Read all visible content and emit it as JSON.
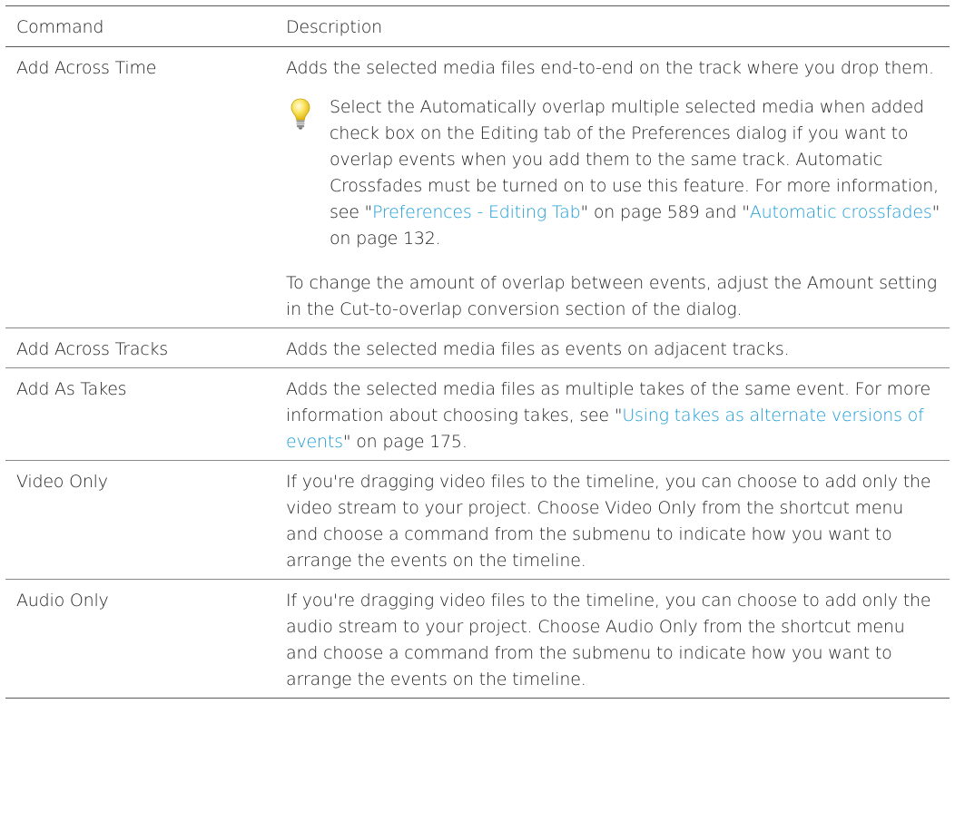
{
  "table": {
    "headers": {
      "command": "Command",
      "description": "Description"
    },
    "rows": [
      {
        "command": "Add Across Time",
        "description": "Adds the selected media files end-to-end on the track where you drop them.",
        "tip": {
          "icon": "lightbulb-icon",
          "text_before": "Select the Automatically overlap multiple selected media when added check box on the Editing tab of the Preferences dialog if you want to overlap events when you add them to the same track. Automatic Crossfades must be turned on to use this feature. For more information, see \"",
          "link1": "Preferences - Editing Tab",
          "text_middle": "\" on page 589 and \"",
          "link2": "Automatic crossfades",
          "text_after": "\" on page 132."
        },
        "extra": "To change the amount of overlap between events, adjust the Amount setting in the Cut-to-overlap conversion section of the dialog."
      },
      {
        "command": "Add Across Tracks",
        "description": "Adds the selected media files as events on adjacent tracks."
      },
      {
        "command": "Add As Takes",
        "description_before": "Adds the selected media files as multiple takes of the same event. For more information about choosing takes, see \"",
        "link": "Using takes as alternate versions of events",
        "description_after": "\" on page 175."
      },
      {
        "command": "Video Only",
        "description": "If you're dragging video files to the timeline, you can choose to add only the video stream to your project. Choose Video Only from the shortcut menu and choose a command from the submenu to indicate how you want to arrange the events on the timeline."
      },
      {
        "command": "Audio Only",
        "description": "If you're dragging video files to the timeline, you can choose to add only the audio stream to your project. Choose Audio Only from the shortcut menu and choose a command from the submenu to indicate how you want to arrange the events on the timeline."
      }
    ]
  },
  "colors": {
    "link": "#1a9bd7",
    "text": "#222222",
    "rule": "#5a5a5a",
    "bulb": "#f2d21b"
  }
}
